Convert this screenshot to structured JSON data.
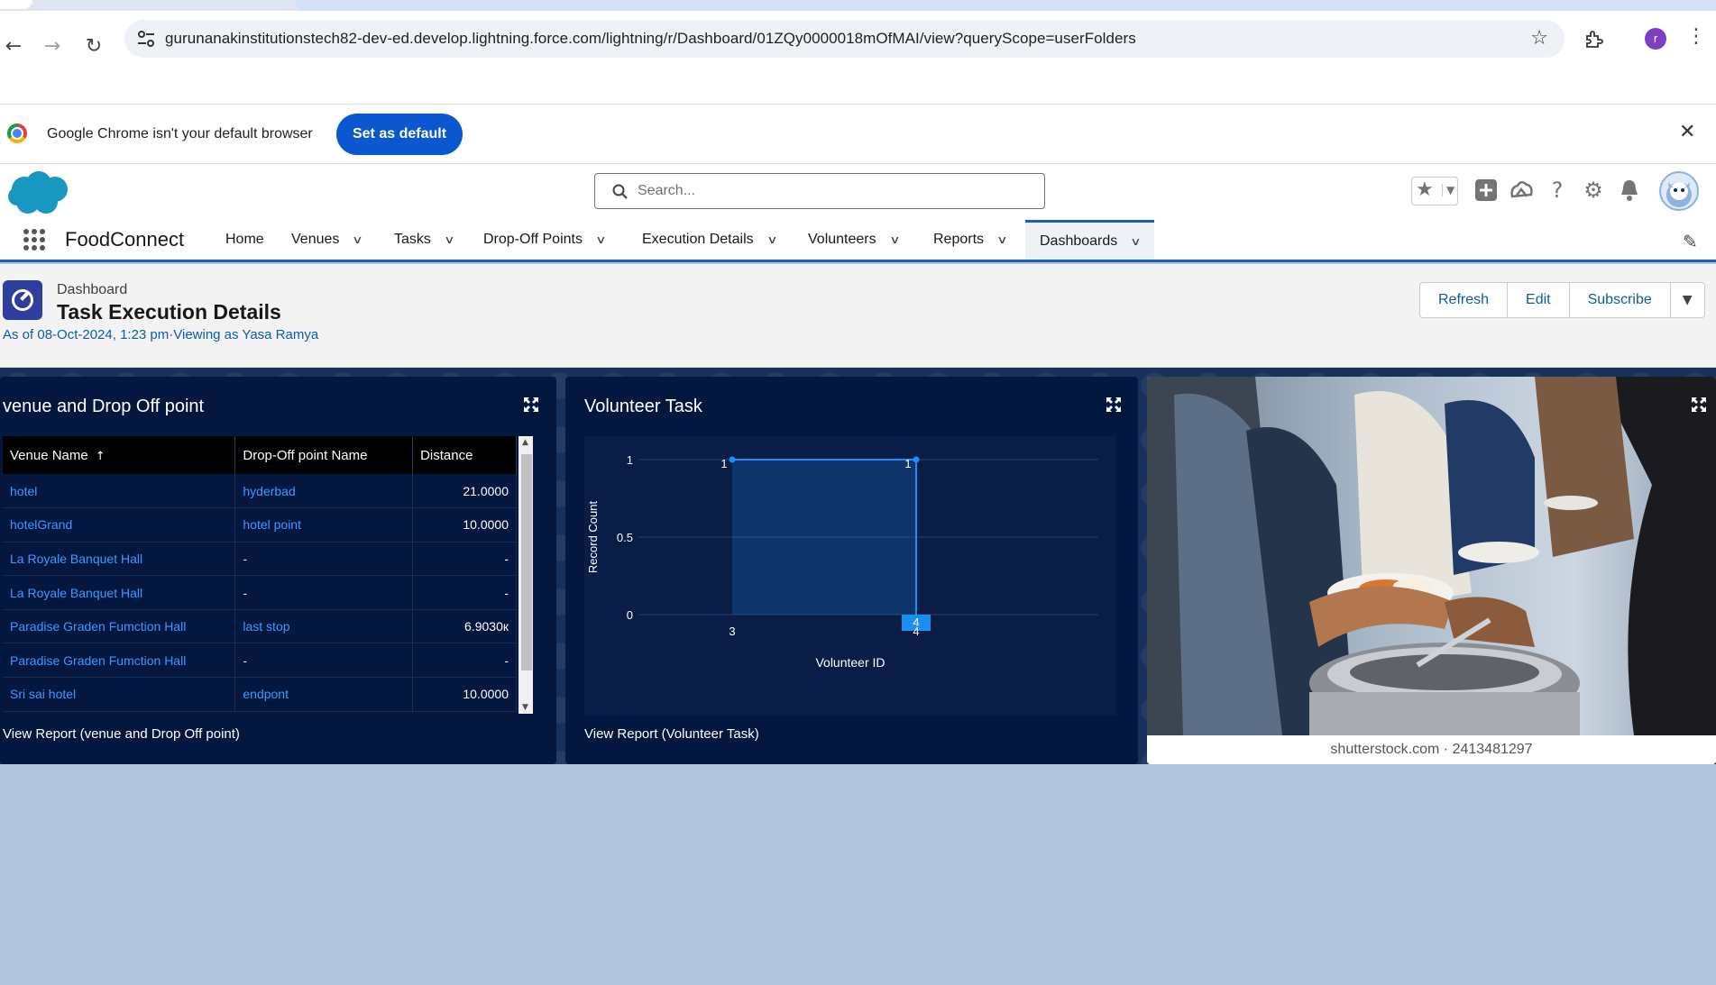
{
  "browser": {
    "url": "gurunanakinstitutionstech82-dev-ed.develop.lightning.force.com/lightning/r/Dashboard/01ZQy0000018mOfMAI/view?queryScope=userFolders",
    "profile_initial": "r"
  },
  "infobar": {
    "message": "Google Chrome isn't your default browser",
    "button": "Set as default"
  },
  "sf": {
    "search_placeholder": "Search...",
    "app_name": "FoodConnect",
    "nav": [
      {
        "label": "Home",
        "dropdown": false
      },
      {
        "label": "Venues",
        "dropdown": true
      },
      {
        "label": "Tasks",
        "dropdown": true
      },
      {
        "label": "Drop-Off Points",
        "dropdown": true
      },
      {
        "label": "Execution Details",
        "dropdown": true
      },
      {
        "label": "Volunteers",
        "dropdown": true
      },
      {
        "label": "Reports",
        "dropdown": true
      },
      {
        "label": "Dashboards",
        "dropdown": true,
        "active": true
      }
    ]
  },
  "dashboard": {
    "type_label": "Dashboard",
    "title": "Task Execution Details",
    "meta": "As of 08-Oct-2024, 1:23 pm·Viewing as Yasa Ramya",
    "buttons": {
      "refresh": "Refresh",
      "edit": "Edit",
      "subscribe": "Subscribe"
    }
  },
  "widget1": {
    "title": "venue and Drop Off point",
    "columns": [
      "Venue Name",
      "Drop-Off point Name",
      "Distance"
    ],
    "sort_indicator": "↑",
    "rows": [
      [
        "hotel",
        "hyderbad",
        "21.0000"
      ],
      [
        "hotelGrand",
        "hotel point",
        "10.0000"
      ],
      [
        "La Royale Banquet Hall",
        "-",
        "-"
      ],
      [
        "La Royale Banquet Hall",
        "-",
        "-"
      ],
      [
        "Paradise Graden Fumction Hall",
        "last stop",
        "6.9030к"
      ],
      [
        "Paradise Graden Fumction Hall",
        "-",
        "-"
      ],
      [
        "Sri sai hotel",
        "endpont",
        "10.0000"
      ]
    ],
    "view_report": "View Report (venue and Drop Off point)"
  },
  "widget2": {
    "title": "Volunteer Task",
    "view_report": "View Report (Volunteer Task)"
  },
  "chart_data": {
    "type": "area",
    "title": "Volunteer Task",
    "xlabel": "Volunteer ID",
    "ylabel": "Record Count",
    "categories": [
      "3",
      "4"
    ],
    "values": [
      1,
      1
    ],
    "ylim": [
      0,
      1
    ],
    "yticks": [
      "0",
      "0.5",
      "1"
    ],
    "highlighted_category": "4",
    "grid": true,
    "color": "#1b8ef2"
  },
  "widget3": {
    "caption": "shutterstock.com · 2413481297"
  },
  "colors": {
    "brand": "#1b5fae",
    "link": "#0b5cab",
    "widget_bg": "#03173f",
    "canvas": "#b0c4de"
  }
}
